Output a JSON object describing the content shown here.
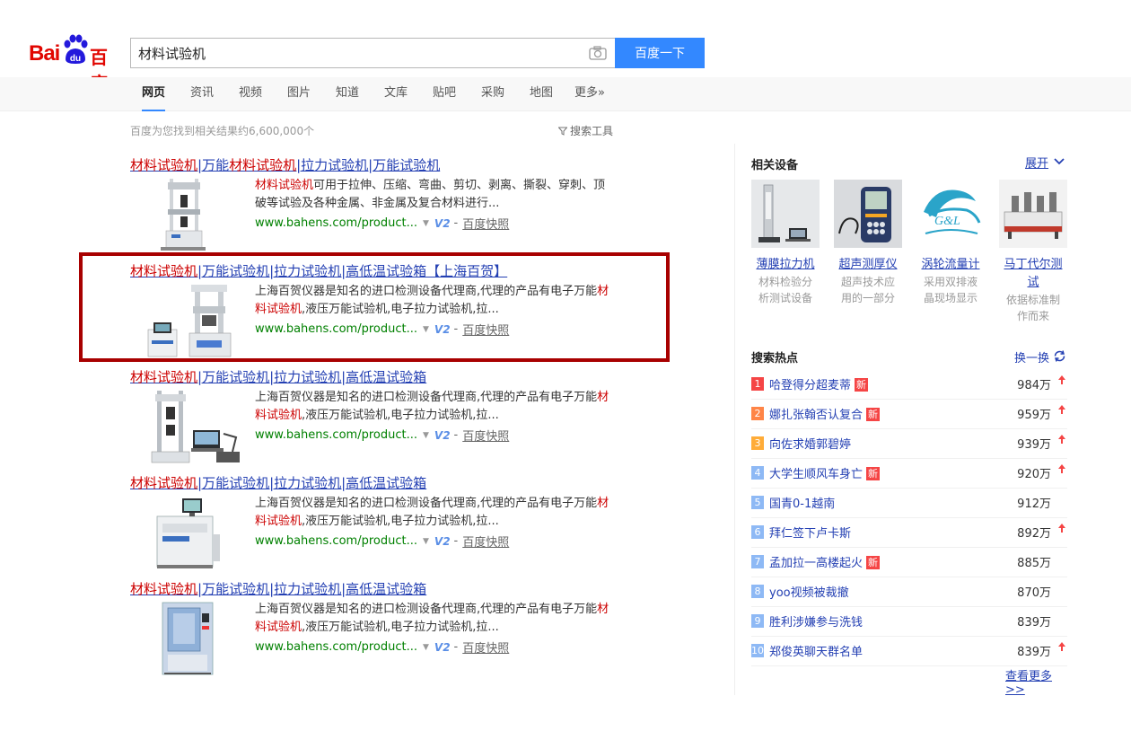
{
  "header": {
    "logo_bai": "Bai",
    "logo_du": "du",
    "logo_cn": "百度",
    "search_value": "材料试验机",
    "search_button": "百度一下",
    "camera_icon": "camera-icon"
  },
  "tabs": [
    {
      "label": "网页",
      "active": true
    },
    {
      "label": "资讯"
    },
    {
      "label": "视频"
    },
    {
      "label": "图片"
    },
    {
      "label": "知道"
    },
    {
      "label": "文库"
    },
    {
      "label": "贴吧"
    },
    {
      "label": "采购"
    },
    {
      "label": "地图"
    },
    {
      "label": "更多»"
    }
  ],
  "result_count": "百度为您找到相关结果约6,600,000个",
  "search_tools": "搜索工具",
  "results": [
    {
      "title_parts": [
        {
          "t": "材料试验机",
          "hl": true
        },
        {
          "t": "|万能",
          "hl": false
        },
        {
          "t": "材料试验机",
          "hl": true
        },
        {
          "t": "|拉力试验机|万能试验机 ",
          "hl": false
        }
      ],
      "abstract_parts": [
        {
          "t": "材料试验机",
          "hl": true
        },
        {
          "t": "可用于拉伸、压缩、弯曲、剪切、剥离、撕裂、穿刺、顶破等试验及各种金属、非金属及复合材料进行...",
          "hl": false
        }
      ],
      "url": "www.bahens.com/product...",
      "badge": "V2",
      "snapshot": "百度快照"
    },
    {
      "title_parts": [
        {
          "t": "材料试验机",
          "hl": true
        },
        {
          "t": "|万能试验机|拉力试验机|高低温试验箱【上海百贺】",
          "hl": false
        }
      ],
      "abstract_parts": [
        {
          "t": "上海百贺仪器是知名的进口检测设备代理商,代理的产品有电子万能",
          "hl": false
        },
        {
          "t": "材料试验机",
          "hl": true
        },
        {
          "t": ",液压万能试验机,电子拉力试验机,拉...",
          "hl": false
        }
      ],
      "url": "www.bahens.com/product...",
      "badge": "V2",
      "snapshot": "百度快照"
    },
    {
      "title_parts": [
        {
          "t": "材料试验机",
          "hl": true
        },
        {
          "t": "|万能试验机|拉力试验机|高低温试验箱 ",
          "hl": false
        }
      ],
      "abstract_parts": [
        {
          "t": "上海百贺仪器是知名的进口检测设备代理商,代理的产品有电子万能",
          "hl": false
        },
        {
          "t": "材料试验机",
          "hl": true
        },
        {
          "t": ",液压万能试验机,电子拉力试验机,拉...",
          "hl": false
        }
      ],
      "url": "www.bahens.com/product...",
      "badge": "V2",
      "snapshot": "百度快照"
    },
    {
      "title_parts": [
        {
          "t": "材料试验机",
          "hl": true
        },
        {
          "t": "|万能试验机|拉力试验机|高低温试验箱 ",
          "hl": false
        }
      ],
      "abstract_parts": [
        {
          "t": "上海百贺仪器是知名的进口检测设备代理商,代理的产品有电子万能",
          "hl": false
        },
        {
          "t": "材料试验机",
          "hl": true
        },
        {
          "t": ",液压万能试验机,电子拉力试验机,拉...",
          "hl": false
        }
      ],
      "url": "www.bahens.com/product...",
      "badge": "V2",
      "snapshot": "百度快照"
    },
    {
      "title_parts": [
        {
          "t": "材料试验机",
          "hl": true
        },
        {
          "t": "|万能试验机|拉力试验机|高低温试验箱 ",
          "hl": false
        }
      ],
      "abstract_parts": [
        {
          "t": "上海百贺仪器是知名的进口检测设备代理商,代理的产品有电子万能",
          "hl": false
        },
        {
          "t": "材料试验机",
          "hl": true
        },
        {
          "t": ",液压万能试验机,电子拉力试验机,拉...",
          "hl": false
        }
      ],
      "url": "www.bahens.com/product...",
      "badge": "V2",
      "snapshot": "百度快照"
    }
  ],
  "related": {
    "title": "相关设备",
    "expand": "展开",
    "items": [
      {
        "name": "薄膜拉力机",
        "desc1": "材料检验分",
        "desc2": "析测试设备"
      },
      {
        "name": "超声测厚仪",
        "desc1": "超声技术应",
        "desc2": "用的一部分"
      },
      {
        "name": "涡轮流量计",
        "desc1": "采用双排液",
        "desc2": "晶现场显示"
      },
      {
        "name1": "马丁代尔测",
        "name2": "试",
        "desc1": "依据标准制",
        "desc2": "作而来"
      }
    ]
  },
  "hot": {
    "title": "搜索热点",
    "refresh": "换一换",
    "new_label": "新",
    "items": [
      {
        "rank": "1",
        "text": "哈登得分超麦蒂",
        "new": true,
        "count": "984万",
        "up": true,
        "color": "#f54545"
      },
      {
        "rank": "2",
        "text": "娜扎张翰否认复合",
        "new": true,
        "count": "959万",
        "up": true,
        "color": "#ff8547"
      },
      {
        "rank": "3",
        "text": "向佐求婚郭碧婷",
        "new": false,
        "count": "939万",
        "up": true,
        "color": "#ffac38"
      },
      {
        "rank": "4",
        "text": "大学生顺风车身亡",
        "new": true,
        "count": "920万",
        "up": true,
        "color": "#8eb9f5"
      },
      {
        "rank": "5",
        "text": "国青0-1越南",
        "new": false,
        "count": "912万",
        "up": false,
        "color": "#8eb9f5"
      },
      {
        "rank": "6",
        "text": "拜仁签下卢卡斯",
        "new": false,
        "count": "892万",
        "up": true,
        "color": "#8eb9f5"
      },
      {
        "rank": "7",
        "text": "孟加拉一高楼起火",
        "new": true,
        "count": "885万",
        "up": false,
        "color": "#8eb9f5"
      },
      {
        "rank": "8",
        "text": "yoo视频被裁撤",
        "new": false,
        "count": "870万",
        "up": false,
        "color": "#8eb9f5"
      },
      {
        "rank": "9",
        "text": "胜利涉嫌参与洗钱",
        "new": false,
        "count": "839万",
        "up": false,
        "color": "#8eb9f5"
      },
      {
        "rank": "10",
        "text": "郑俊英聊天群名单",
        "new": false,
        "count": "839万",
        "up": true,
        "color": "#8eb9f5"
      }
    ],
    "more": "查看更多>>"
  }
}
